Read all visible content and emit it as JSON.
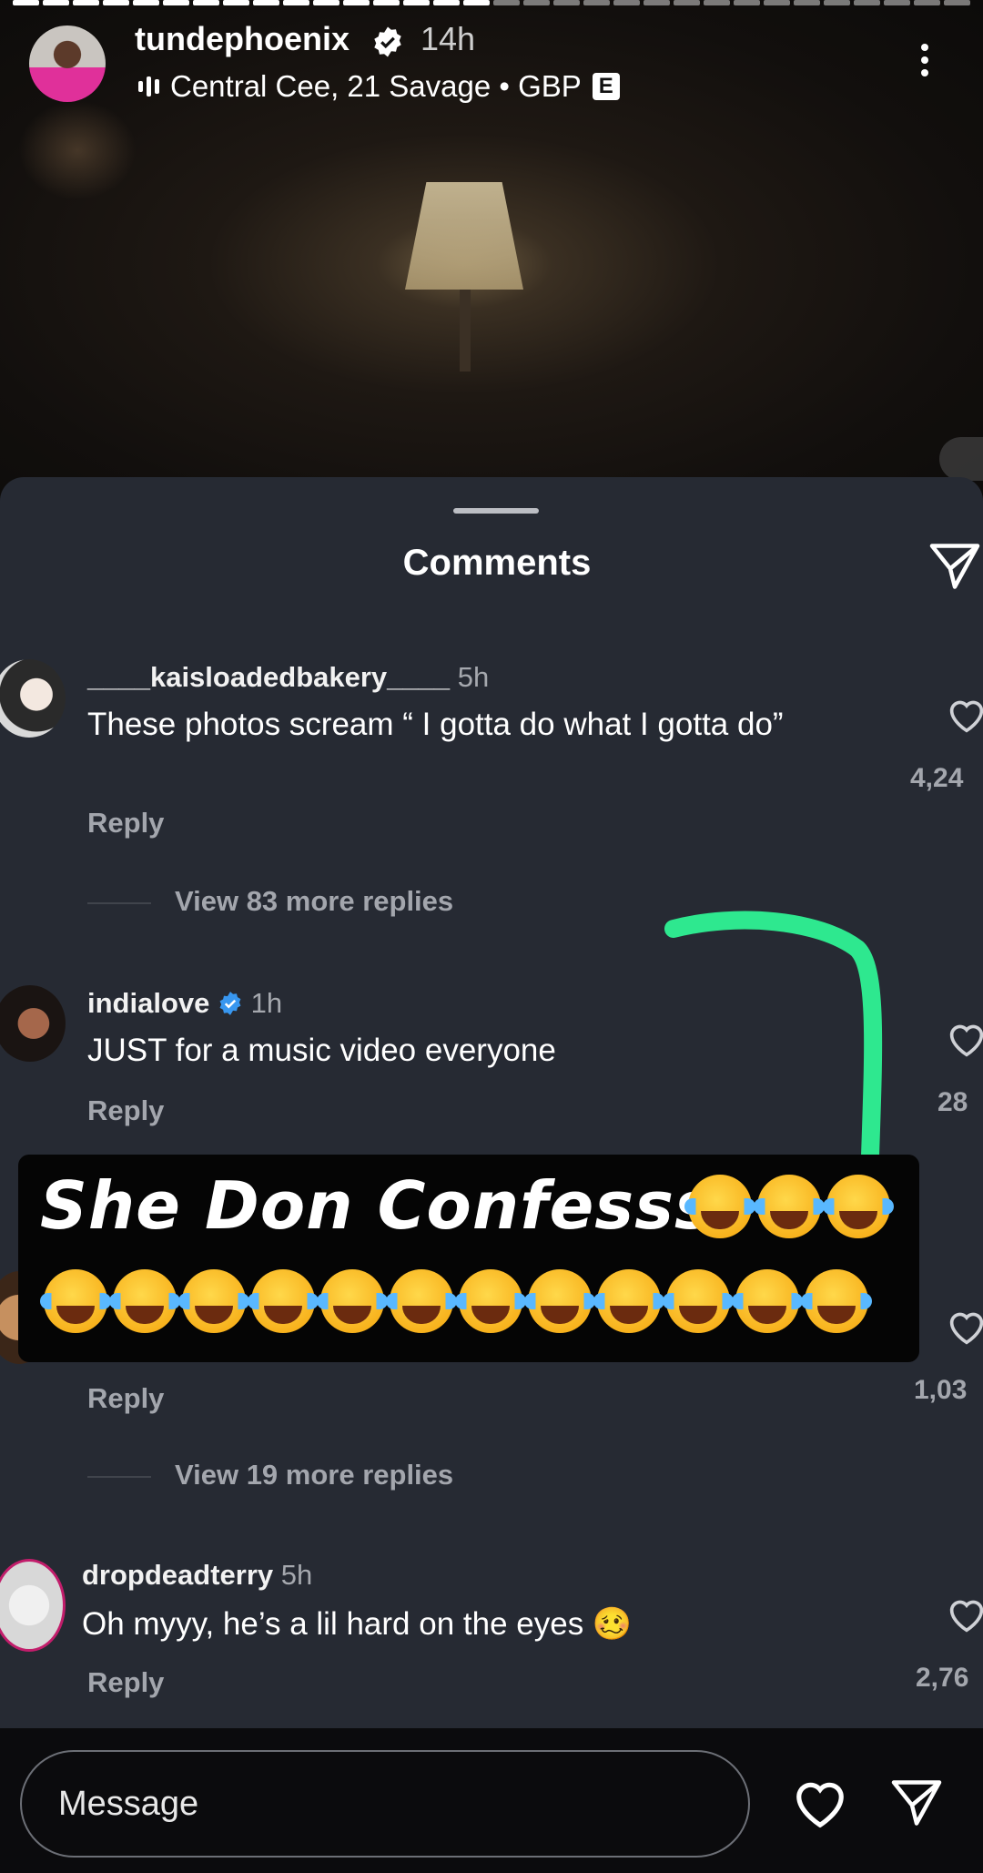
{
  "story": {
    "username": "tundephoenix",
    "time": "14h",
    "music": "Central Cee, 21 Savage • GBP",
    "explicit_badge": "E"
  },
  "comments_sheet": {
    "title": "Comments",
    "comments": [
      {
        "username": "____kaisloadedbakery____",
        "time": "5h",
        "text": "These photos scream “ I gotta do what I gotta do”",
        "reply_label": "Reply",
        "likes": "4,24",
        "view_more": "View 83 more replies"
      },
      {
        "username": "indialove",
        "time": "1h",
        "text": "JUST for a music video everyone",
        "reply_label": "Reply",
        "likes": "28"
      },
      {
        "reply_label": "Reply",
        "likes": "1,03",
        "view_more": "View 19 more replies"
      },
      {
        "username": "dropdeadterry",
        "time": "5h",
        "text": "Oh myyy, he’s a lil hard on the eyes 🥴",
        "reply_label": "Reply",
        "likes": "2,76"
      }
    ]
  },
  "overlay": {
    "caption": "She Don Confesss",
    "arrow_color": "#2ee88f"
  },
  "message_bar": {
    "placeholder": "Message"
  }
}
